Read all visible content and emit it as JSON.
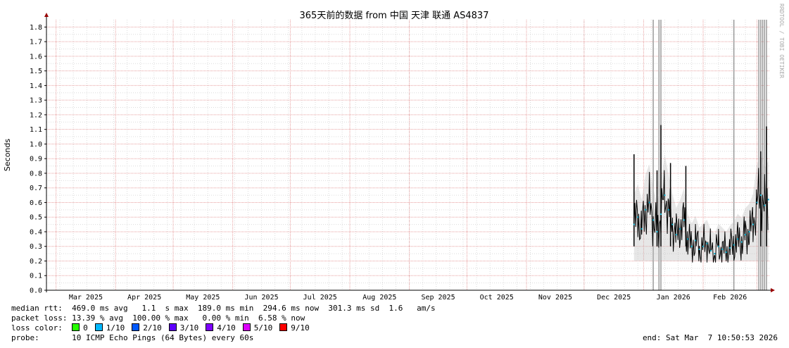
{
  "chart_data": {
    "type": "area",
    "title": "365天前的数据 from 中国 天津 联通 AS4837",
    "ylabel": "Seconds",
    "ylim": [
      0,
      1.85
    ],
    "y_ticks": [
      "0.0",
      "0.1",
      "0.2",
      "0.3",
      "0.4",
      "0.5",
      "0.6",
      "0.7",
      "0.8",
      "0.9",
      "1.0",
      "1.1",
      "1.2",
      "1.3",
      "1.4",
      "1.5",
      "1.6",
      "1.7",
      "1.8"
    ],
    "x_tick_labels": [
      "Mar 2025",
      "Apr 2025",
      "May 2025",
      "Jun 2025",
      "Jul 2025",
      "Aug 2025",
      "Sep 2025",
      "Oct 2025",
      "Nov 2025",
      "Dec 2025",
      "Jan 2026",
      "Feb 2026"
    ],
    "grid": true,
    "series": [
      {
        "name": "median rtt",
        "x": [
          "2025-12-27",
          "2025-12-29",
          "2025-12-31",
          "2026-01-02",
          "2026-01-04",
          "2026-01-06",
          "2026-01-08",
          "2026-01-10",
          "2026-01-12",
          "2026-01-14",
          "2026-01-16",
          "2026-01-18",
          "2026-01-20",
          "2026-01-22",
          "2026-01-24",
          "2026-01-26",
          "2026-01-28",
          "2026-01-30",
          "2026-02-01",
          "2026-02-03",
          "2026-02-05",
          "2026-02-07",
          "2026-02-09",
          "2026-02-11",
          "2026-02-13",
          "2026-02-15",
          "2026-02-17",
          "2026-02-19",
          "2026-02-21",
          "2026-02-23",
          "2026-02-25",
          "2026-02-27",
          "2026-03-01",
          "2026-03-03",
          "2026-03-05",
          "2026-03-07"
        ],
        "values": [
          0.45,
          0.5,
          0.42,
          0.55,
          0.6,
          0.48,
          0.4,
          0.52,
          0.65,
          0.55,
          0.45,
          0.38,
          0.42,
          0.48,
          0.35,
          0.3,
          0.34,
          0.28,
          0.3,
          0.32,
          0.27,
          0.25,
          0.3,
          0.28,
          0.26,
          0.29,
          0.31,
          0.35,
          0.33,
          0.38,
          0.4,
          0.45,
          0.6,
          0.65,
          0.58,
          0.62
        ]
      }
    ],
    "peaks": [
      {
        "x": "2025-12-27",
        "y": 0.93
      },
      {
        "x": "2026-01-08",
        "y": 0.82
      },
      {
        "x": "2026-01-10",
        "y": 1.13
      },
      {
        "x": "2026-01-15",
        "y": 0.87
      },
      {
        "x": "2026-01-23",
        "y": 0.85
      },
      {
        "x": "2026-03-03",
        "y": 0.95
      },
      {
        "x": "2026-03-06",
        "y": 1.12
      }
    ],
    "outage_spikes": [
      "2026-01-06",
      "2026-01-09",
      "2026-01-10",
      "2026-02-17",
      "2026-03-02",
      "2026-03-03",
      "2026-03-04",
      "2026-03-05",
      "2026-03-06"
    ],
    "colors": {
      "background": "#ffffff",
      "grid_minor": "#dcdcdc",
      "grid_major": "#e8a0a0",
      "axis": "#000000",
      "arrow": "#990000",
      "rtt": "#000000",
      "smoke": "#bbbbbb",
      "loss_spike": "#9a9a9a",
      "median_dot": "#00aacc"
    }
  },
  "side_text": "RRDTOOL / TOBI OETIKER",
  "legend": {
    "median_label": "median rtt:",
    "median_values": "469.0 ms avg   1.1  s max  189.0 ms min  294.6 ms now  301.3 ms sd  1.6   am/s",
    "loss_label": "packet loss:",
    "loss_values": "13.39 % avg  100.00 % max   0.00 % min  6.58 % now",
    "loss_color_label": "loss color:",
    "loss_colors": [
      {
        "label": "0",
        "color": "#26ff00"
      },
      {
        "label": "1/10",
        "color": "#00b8ff"
      },
      {
        "label": "2/10",
        "color": "#0059ff"
      },
      {
        "label": "3/10",
        "color": "#5e00ff"
      },
      {
        "label": "4/10",
        "color": "#7e00ff"
      },
      {
        "label": "5/10",
        "color": "#dd00ff"
      },
      {
        "label": "9/10",
        "color": "#ff0000"
      }
    ],
    "probe_label": "probe:",
    "probe_value": "10 ICMP Echo Pings (64 Bytes) every 60s",
    "end_text": "end: Sat Mar  7 10:50:53 2026"
  }
}
